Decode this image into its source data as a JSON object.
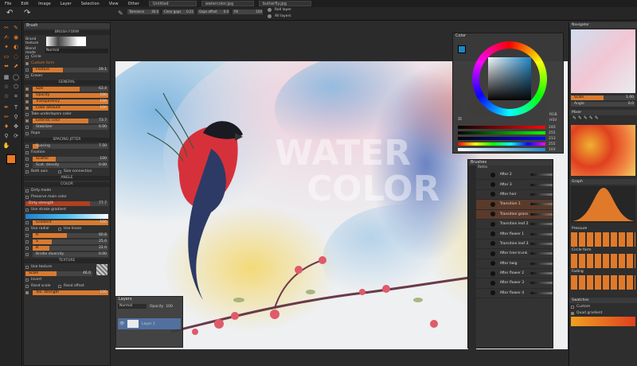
{
  "menu": {
    "items": [
      "File",
      "Edit",
      "Image",
      "Layer",
      "Selection",
      "View",
      "Other"
    ],
    "tabs": [
      "Untitled",
      "watercolor.jpg",
      "butterfly.jpg"
    ]
  },
  "topbar": {
    "tolerance_label": "Tolerance",
    "tolerance_value": "30.0",
    "clear_gaps_label": "Clear gaps",
    "clear_gaps_value": "0.21",
    "gaps_offset_label": "Gaps offset",
    "gaps_offset_value": "0.0",
    "fill_label": "Fill",
    "fill_value": "100",
    "roll_layer": "Roll layer",
    "all_layers": "All layers"
  },
  "brush": {
    "title": "Brush",
    "section_form": "BRUSH FORM",
    "brush_texture": "Brand texture",
    "blend_mode_label": "Blend mode",
    "blend_mode_value": "Normal",
    "circle": "Circle",
    "custom_form": "Custom form",
    "feature_label": "Feature",
    "feature_value": "29.1",
    "eraser": "Eraser",
    "section_general": "GENERAL",
    "general": [
      {
        "label": "Size",
        "value": "63.4",
        "pct": 0.62
      },
      {
        "label": "Opacity",
        "value": "100",
        "pct": 1
      },
      {
        "label": "Transparency",
        "value": "100",
        "pct": 1
      },
      {
        "label": "Color amount",
        "value": "100",
        "pct": 1
      }
    ],
    "take_underlayers": "Take underlayers color",
    "extends_label": "Extends color",
    "extends_value": "73.7",
    "extends_pct": 0.74,
    "stabilizer_label": "Stabilizer",
    "stabilizer_value": "0.00",
    "rope": "Rope",
    "section_spacing": "SPACING JITTER",
    "spacing": {
      "label": "Spacing",
      "value": "7.50",
      "pct": 0.07
    },
    "fixation": "Fixation",
    "scatter": {
      "label": "Scatter",
      "value": "100",
      "pct": 0.3
    },
    "scat_density": {
      "label": "Scat. density",
      "value": "0.00",
      "pct": 0
    },
    "both_axis": "Both axis",
    "size_connection": "Size connection",
    "section_angle": "ANGLE",
    "section_color": "COLOR",
    "dirty_mode": "Dirty mode",
    "preserve_main": "Preserve main color",
    "dirty_strength": {
      "label": "Dirty strength",
      "value": "77.7",
      "pct": 0.78
    },
    "use_stroke_gradient": "Use stroke gradient",
    "gradient": {
      "label": "Gradient",
      "value": "100",
      "pct": 1
    },
    "use_radial": "Use radial",
    "use_linear": "Use linear",
    "hsb": [
      {
        "label": "H",
        "value": "60.8",
        "pct": 0.45
      },
      {
        "label": "S",
        "value": "25.0",
        "pct": 0.25
      },
      {
        "label": "B",
        "value": "22.0",
        "pct": 0.22
      }
    ],
    "bristle": {
      "label": "Bristle diversity",
      "value": "0.00",
      "pct": 0
    },
    "section_texture": "TEXTURE",
    "use_texture": "Use texture",
    "scale": {
      "label": "Scale",
      "value": "46.0",
      "pct": 0.46
    },
    "invert": "Invert",
    "rand_scale": "Rand scale",
    "rand_offset": "Rand offset",
    "tex_strength": {
      "label": "Tex. strength",
      "value": "100",
      "pct": 1
    }
  },
  "canvas": {
    "text1": "WATER",
    "text2": "COLOR"
  },
  "color": {
    "title": "Color",
    "rgb": "RGB",
    "hsv": "HSV",
    "values": [
      "240",
      "255",
      "213",
      "255",
      "103"
    ],
    "swatch": "#1e88c8"
  },
  "brushes_panel": {
    "title": "Brushes",
    "group": "Retro",
    "items": [
      "After 2",
      "After 3",
      "After hair",
      "Transition 1",
      "Transition grass",
      "Transition leaf 2",
      "After flower 1",
      "Transition leaf 3",
      "After tree trunk",
      "After twig",
      "After flower 2",
      "After flower 3",
      "After flower 4"
    ]
  },
  "layers": {
    "title": "Layers",
    "blend": "Normal",
    "opacity_label": "Opacity",
    "opacity_value": "100",
    "layer_name": "Layer 1"
  },
  "right": {
    "navigator": "Navigator",
    "scale_label": "Scale",
    "scale_value": "1.00",
    "angle_label": "Angle",
    "angle_value": "0.0",
    "mixer": "Mixer",
    "graph": "Graph",
    "pressure": "Pressure",
    "circle_form": "Circle form",
    "fading": "Fading",
    "swatches": "Swatches",
    "custom": "Custom",
    "quad_gradient": "Quad gradient"
  }
}
